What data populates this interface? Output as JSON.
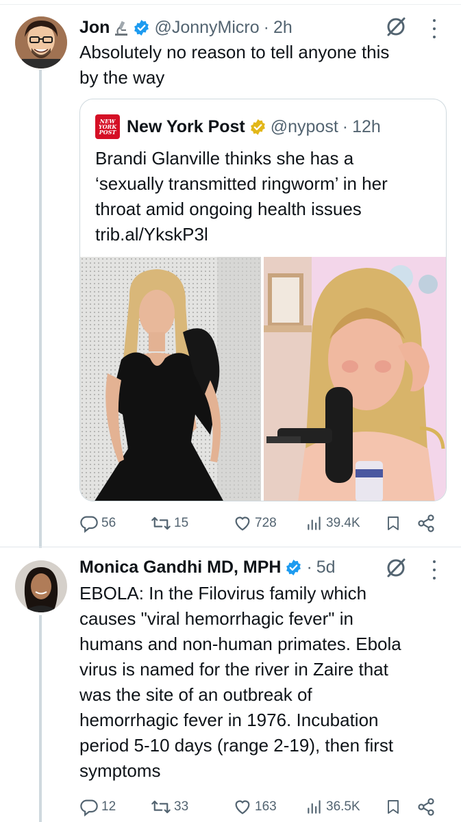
{
  "tweets": [
    {
      "author_name": "Jon",
      "author_emoji": "microscope",
      "handle": "@JonnyMicro",
      "dot": "·",
      "time": "2h",
      "text_lines": [
        "Absolutely no reason to tell anyone this",
        "by the way"
      ],
      "quote": {
        "source_name": "New York Post",
        "logo_text": [
          "NEW",
          "YORK",
          "POST"
        ],
        "handle": "@nypost",
        "dot": "·",
        "time": "12h",
        "text_lines": [
          "Brandi Glanville thinks she has a",
          "‘sexually transmitted ringworm’ in her",
          "throat amid ongoing health issues",
          "trib.al/YkskP3l"
        ],
        "images": [
          "photo-woman-black-dress",
          "photo-woman-podcast-microphone"
        ]
      },
      "stats": {
        "replies": "56",
        "reposts": "15",
        "likes": "728",
        "views": "39.4K"
      }
    },
    {
      "author_name": "Monica Gandhi MD, MPH",
      "handle": "",
      "dot": "·",
      "time": "5d",
      "text_lines": [
        "EBOLA: In the Filovirus family which",
        "causes \"viral hemorrhagic fever\" in",
        "humans and non-human primates.  Ebola",
        "virus is named for the river in Zaire that",
        "was the site of an outbreak of",
        "hemorrhagic fever in 1976. Incubation",
        "period 5-10 days (range 2-19), then first",
        "symptoms"
      ],
      "stats": {
        "replies": "12",
        "reposts": "33",
        "likes": "163",
        "views": "36.5K"
      }
    }
  ],
  "colors": {
    "verified_blue": "#1d9bf0",
    "verified_gold": "#e2b719",
    "nyp_red": "#d50f25",
    "secondary_text": "#536471"
  },
  "icons": [
    "grok-icon",
    "more-icon",
    "reply-icon",
    "repost-icon",
    "like-icon",
    "views-icon",
    "bookmark-icon",
    "share-icon"
  ]
}
